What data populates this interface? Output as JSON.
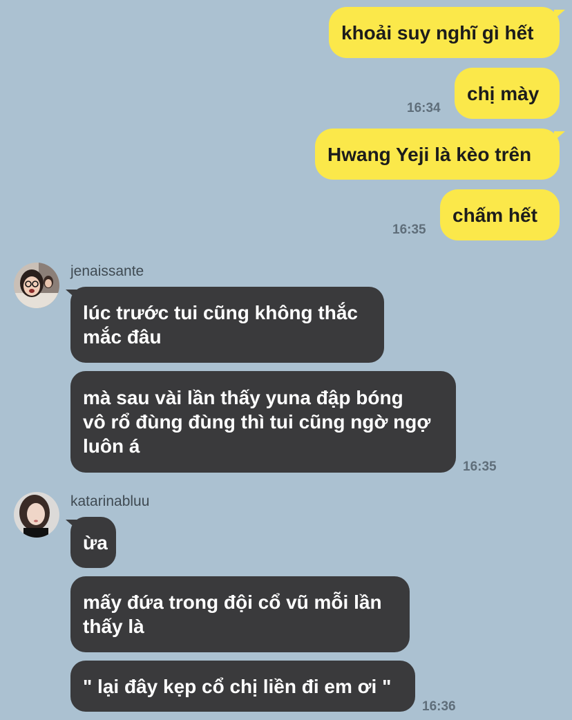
{
  "outgoing": [
    {
      "text": "khoải suy nghĩ gì hết"
    },
    {
      "text": "chị mày",
      "time": "16:34"
    },
    {
      "text": "Hwang Yeji là kèo trên"
    },
    {
      "text": "chấm hết",
      "time": "16:35"
    }
  ],
  "groups": [
    {
      "sender": "jenaissante",
      "avatar_icon": "profile-photo-icon",
      "messages": [
        {
          "line1": "lúc trước tui cũng không thắc",
          "line2": "mắc đâu"
        },
        {
          "line1": "mà sau vài lần thấy yuna đập bóng",
          "line2": "vô rổ đùng đùng thì tui cũng ngờ ngợ",
          "line3": "luôn á",
          "time": "16:35"
        }
      ]
    },
    {
      "sender": "katarinabluu",
      "avatar_icon": "profile-photo-icon",
      "messages": [
        {
          "line1": "ừa"
        },
        {
          "line1": "mấy đứa trong đội cổ vũ mỗi lần",
          "line2": "thấy là"
        },
        {
          "line1": "\" lại đây kẹp cổ chị liền đi em ơi \"",
          "time": "16:36"
        }
      ]
    }
  ],
  "colors": {
    "background": "#abc1d1",
    "outgoing_bubble": "#fbe84a",
    "incoming_bubble": "#3a3a3c"
  }
}
